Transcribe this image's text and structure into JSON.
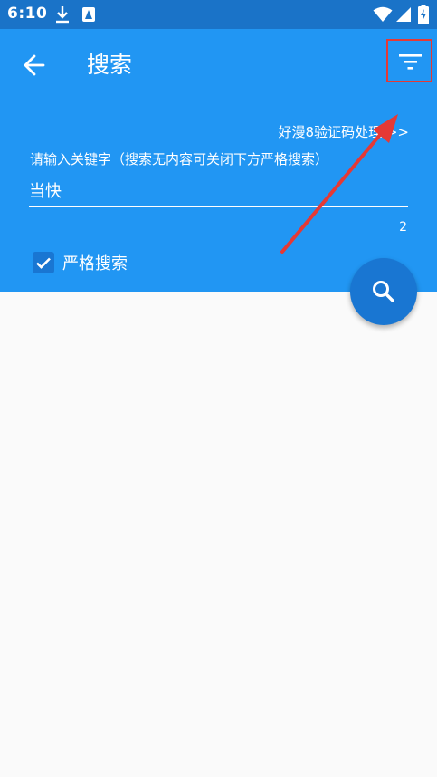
{
  "status_bar": {
    "time": "6:10"
  },
  "header": {
    "title": "搜索",
    "captcha_link": "好漫8验证码处理 >>",
    "field_label": "请输入关键字（搜索无内容可关闭下方严格搜索）",
    "search_value": "当快",
    "result_count": "2",
    "strict_label": "严格搜索",
    "strict_checked": true
  },
  "colors": {
    "status_bar": "#1a73c8",
    "header": "#2196f3",
    "fab": "#1976d2",
    "annotation": "#e53935"
  }
}
